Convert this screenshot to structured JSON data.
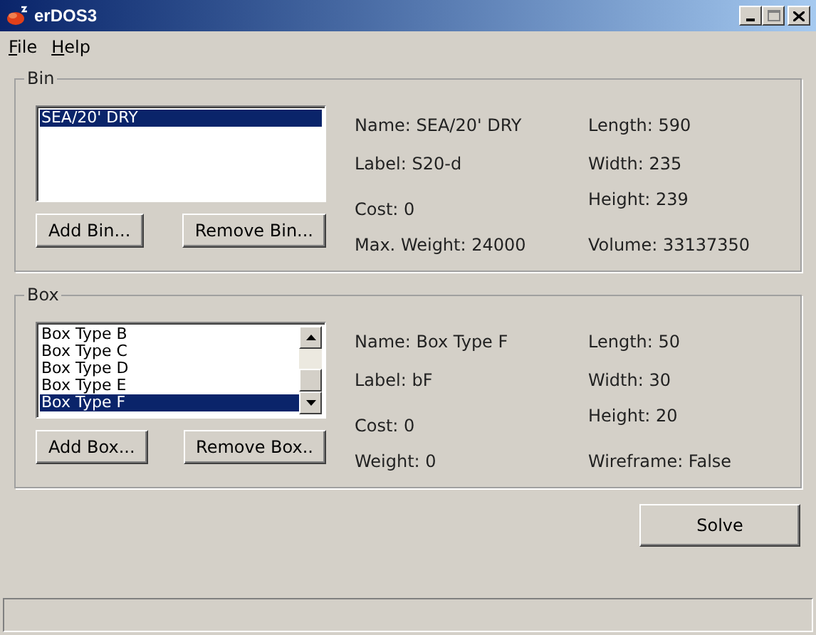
{
  "window": {
    "title": "erDOS3"
  },
  "menu": [
    "File",
    "Help"
  ],
  "bin": {
    "title": "Bin",
    "items": [
      {
        "label": "SEA/20' DRY",
        "selected": true
      }
    ],
    "buttons": [
      "Add Bin...",
      "Remove Bin..."
    ],
    "details_left": [
      "Name: SEA/20' DRY",
      "Label: S20-d",
      "Cost: 0",
      "Max. Weight: 24000"
    ],
    "details_right": [
      "Length: 590",
      "Width: 235",
      "Height: 239",
      "Volume: 33137350"
    ]
  },
  "box": {
    "title": "Box",
    "items": [
      {
        "label": "Box Type B",
        "selected": false
      },
      {
        "label": "Box Type C",
        "selected": false
      },
      {
        "label": "Box Type D",
        "selected": false
      },
      {
        "label": "Box Type E",
        "selected": false
      },
      {
        "label": "Box Type F",
        "selected": true
      }
    ],
    "buttons": [
      "Add Box...",
      "Remove Box.."
    ],
    "details_left": [
      "Name: Box Type F",
      "Label: bF",
      "Cost: 0",
      "Weight: 0"
    ],
    "details_right": [
      "Length: 50",
      "Width: 30",
      "Height: 20",
      "Wireframe: False"
    ]
  },
  "solve_button": "Solve"
}
